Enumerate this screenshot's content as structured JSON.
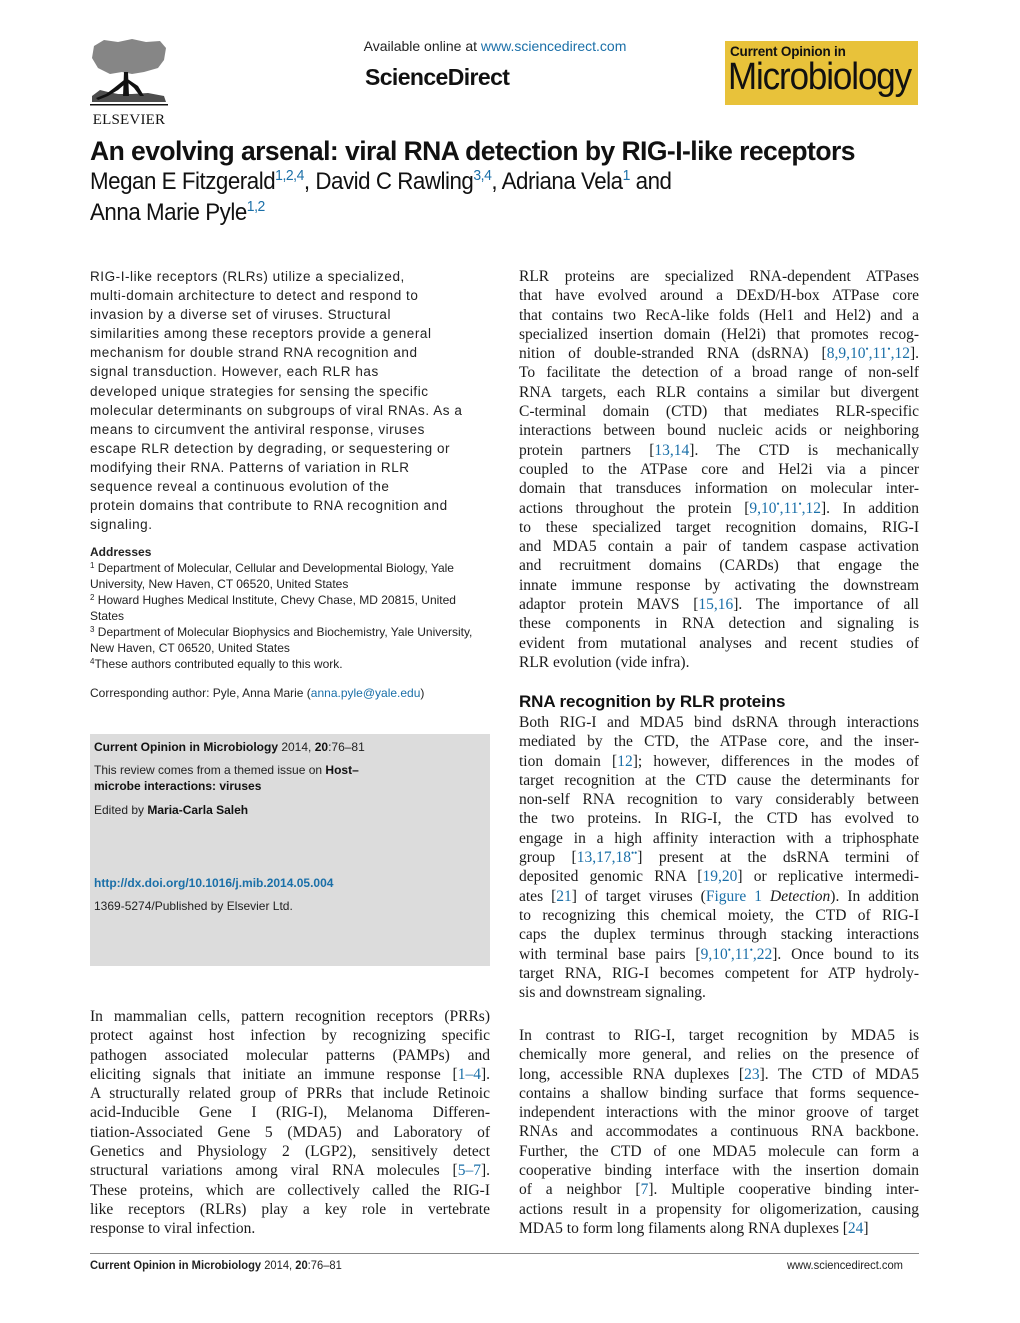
{
  "header": {
    "publisher_logo_text": "ELSEVIER",
    "available_prefix": "Available online at ",
    "available_link": "www.sciencedirect.com",
    "platform_name": "ScienceDirect",
    "journal_badge_small": "Current Opinion in",
    "journal_badge_large": "Microbiology",
    "journal_badge_color": "#e8c23a"
  },
  "article": {
    "title": "An evolving arsenal: viral RNA detection by RIG-I-like receptors",
    "authors": [
      {
        "name": "Megan E Fitzgerald",
        "affil": "1,2,4",
        "sep": ", "
      },
      {
        "name": "David C Rawling",
        "affil": "3,4",
        "sep": ", "
      },
      {
        "name": "Adriana Vela",
        "affil": "1",
        "sep": " and"
      },
      {
        "name": "Anna Marie Pyle",
        "affil": "1,2",
        "sep": ""
      }
    ]
  },
  "abstract_lines": [
    "RIG-I-like receptors (RLRs) utilize a specialized,",
    "multi-domain architecture to detect and respond to",
    "invasion by a diverse set of viruses. Structural",
    "similarities among these receptors provide a general",
    "mechanism for double strand RNA recognition and",
    "signal transduction. However, each RLR has",
    "developed unique strategies for sensing the specific",
    "molecular determinants on subgroups of viral RNAs. As a",
    "means to circumvent the antiviral response, viruses",
    "escape RLR detection by degrading, or sequestering or",
    "modifying their RNA. Patterns of variation in RLR",
    "sequence reveal a continuous evolution of the",
    "protein domains that contribute to RNA recognition and",
    "signaling."
  ],
  "addresses": {
    "heading": "Addresses",
    "lines": [
      {
        "sup": "1",
        "text": " Department of Molecular, Cellular and Developmental Biology, Yale"
      },
      {
        "sup": "",
        "text": "University, New Haven, CT 06520, United States"
      },
      {
        "sup": "2",
        "text": " Howard Hughes Medical Institute, Chevy Chase, MD 20815, United"
      },
      {
        "sup": "",
        "text": "States"
      },
      {
        "sup": "3",
        "text": " Department of Molecular Biophysics and Biochemistry, Yale University,"
      },
      {
        "sup": "",
        "text": "New Haven, CT 06520, United States"
      },
      {
        "sup": "4",
        "text": "These authors contributed equally to this work."
      }
    ],
    "corresponding_prefix": "Corresponding author: Pyle, Anna Marie (",
    "corresponding_email": "anna.pyle@yale.edu",
    "corresponding_suffix": ")"
  },
  "infobox": {
    "journal": "Current Opinion in Microbiology",
    "year": " 2014, ",
    "volume": "20",
    "pages": ":76–81",
    "themed_prefix": "This review comes from a themed issue on ",
    "themed_issue_1": "Host–",
    "themed_issue_2": "microbe interactions: viruses",
    "edited_prefix": "Edited by ",
    "editor": "Maria-Carla Saleh",
    "doi": "http://dx.doi.org/10.1016/j.mib.2014.05.004",
    "issn": "1369-5274/Published by Elsevier Ltd."
  },
  "body": {
    "intro": [
      [
        {
          "t": "In mammalian cells, pattern recognition receptors (PRRs)"
        }
      ],
      [
        {
          "t": "protect against host infection by recognizing specific"
        }
      ],
      [
        {
          "t": "pathogen associated molecular patterns (PAMPs) and"
        }
      ],
      [
        {
          "t": "eliciting signals that initiate an immune response ["
        },
        {
          "t": "1–4",
          "k": "link"
        },
        {
          "t": "]."
        }
      ],
      [
        {
          "t": "A structurally related group of PRRs that include Retinoic"
        }
      ],
      [
        {
          "t": "acid-Inducible Gene I (RIG-I), Melanoma Differen-"
        }
      ],
      [
        {
          "t": "tiation-Associated Gene 5 (MDA5) and Laboratory of"
        }
      ],
      [
        {
          "t": "Genetics and Physiology 2 (LGP2), sensitively detect"
        }
      ],
      [
        {
          "t": "structural variations among viral RNA molecules ["
        },
        {
          "t": "5–7",
          "k": "link"
        },
        {
          "t": "]."
        }
      ],
      [
        {
          "t": "These proteins, which are collectively called the RIG-I"
        }
      ],
      [
        {
          "t": "like receptors (RLRs) play a key role in vertebrate"
        }
      ],
      [
        {
          "t": "response to viral infection."
        }
      ]
    ],
    "right1": [
      [
        {
          "t": "RLR proteins are specialized RNA-dependent ATPases"
        }
      ],
      [
        {
          "t": "that have evolved around a DExD/H-box ATPase core"
        }
      ],
      [
        {
          "t": "that contains two RecA-like folds (Hel1 and Hel2) and a"
        }
      ],
      [
        {
          "t": "specialized insertion domain (Hel2i) that promotes recog-"
        }
      ],
      [
        {
          "t": "nition of double-stranded RNA (dsRNA) ["
        },
        {
          "t": "8,9,10",
          "k": "link"
        },
        {
          "t": "•",
          "k": "sup"
        },
        {
          "t": ",11",
          "k": "link"
        },
        {
          "t": "•",
          "k": "sup"
        },
        {
          "t": ",12",
          "k": "link"
        },
        {
          "t": "]."
        }
      ],
      [
        {
          "t": "To facilitate the detection of a broad range of non-self"
        }
      ],
      [
        {
          "t": "RNA targets, each RLR contains a similar but divergent"
        }
      ],
      [
        {
          "t": "C-terminal domain (CTD) that mediates RLR-specific"
        }
      ],
      [
        {
          "t": "interactions between bound nucleic acids or neighboring"
        }
      ],
      [
        {
          "t": "protein partners ["
        },
        {
          "t": "13,14",
          "k": "link"
        },
        {
          "t": "]. The CTD is mechanically"
        }
      ],
      [
        {
          "t": "coupled to the ATPase core and Hel2i via a pincer"
        }
      ],
      [
        {
          "t": "domain that transduces information on molecular inter-"
        }
      ],
      [
        {
          "t": "actions throughout the protein ["
        },
        {
          "t": "9,10",
          "k": "link"
        },
        {
          "t": "•",
          "k": "sup"
        },
        {
          "t": ",11",
          "k": "link"
        },
        {
          "t": "•",
          "k": "sup"
        },
        {
          "t": ",12",
          "k": "link"
        },
        {
          "t": "]. In addition"
        }
      ],
      [
        {
          "t": "to these specialized target recognition domains, RIG-I"
        }
      ],
      [
        {
          "t": "and MDA5 contain a pair of tandem caspase activation"
        }
      ],
      [
        {
          "t": "and recruitment domains (CARDs) that engage the"
        }
      ],
      [
        {
          "t": "innate immune response by activating the downstream"
        }
      ],
      [
        {
          "t": "adaptor protein MAVS ["
        },
        {
          "t": "15,16",
          "k": "link"
        },
        {
          "t": "]. The importance of all"
        }
      ],
      [
        {
          "t": "these components in RNA detection and signaling is"
        }
      ],
      [
        {
          "t": "evident from mutational analyses and recent studies of"
        }
      ],
      [
        {
          "t": "RLR evolution (vide infra)."
        }
      ]
    ],
    "section_heading": "RNA recognition by RLR proteins",
    "right2": [
      [
        {
          "t": "Both RIG-I and MDA5 bind dsRNA through interactions"
        }
      ],
      [
        {
          "t": "mediated by the CTD, the ATPase core, and the inser-"
        }
      ],
      [
        {
          "t": "tion domain ["
        },
        {
          "t": "12",
          "k": "link"
        },
        {
          "t": "]; however, differences in the modes of"
        }
      ],
      [
        {
          "t": "target recognition at the CTD cause the determinants for"
        }
      ],
      [
        {
          "t": "non-self RNA recognition to vary considerably between"
        }
      ],
      [
        {
          "t": "the two proteins. In RIG-I, the CTD has evolved to"
        }
      ],
      [
        {
          "t": "engage in a high affinity interaction with a triphosphate"
        }
      ],
      [
        {
          "t": "group ["
        },
        {
          "t": "13,17,18",
          "k": "link"
        },
        {
          "t": "••",
          "k": "sup"
        },
        {
          "t": "] present at the dsRNA termini of"
        }
      ],
      [
        {
          "t": "deposited genomic RNA ["
        },
        {
          "t": "19,20",
          "k": "link"
        },
        {
          "t": "] or replicative intermedi-"
        }
      ],
      [
        {
          "t": "ates ["
        },
        {
          "t": "21",
          "k": "link"
        },
        {
          "t": "] of target viruses ("
        },
        {
          "t": "Figure 1",
          "k": "link"
        },
        {
          "t": " "
        },
        {
          "t": "Detection",
          "k": "italic"
        },
        {
          "t": "). In addition"
        }
      ],
      [
        {
          "t": "to recognizing this chemical moiety, the CTD of RIG-I"
        }
      ],
      [
        {
          "t": "caps the duplex terminus through stacking interactions"
        }
      ],
      [
        {
          "t": "with terminal base pairs ["
        },
        {
          "t": "9,10",
          "k": "link"
        },
        {
          "t": "•",
          "k": "sup"
        },
        {
          "t": ",11",
          "k": "link"
        },
        {
          "t": "•",
          "k": "sup"
        },
        {
          "t": ",22",
          "k": "link"
        },
        {
          "t": "]. Once bound to its"
        }
      ],
      [
        {
          "t": "target RNA, RIG-I becomes competent for ATP hydroly-"
        }
      ],
      [
        {
          "t": "sis and downstream signaling."
        }
      ]
    ],
    "right3": [
      [
        {
          "t": "In contrast to RIG-I, target recognition by MDA5 is"
        }
      ],
      [
        {
          "t": "chemically more general, and relies on the presence of"
        }
      ],
      [
        {
          "t": "long, accessible RNA duplexes ["
        },
        {
          "t": "23",
          "k": "link"
        },
        {
          "t": "]. The CTD of MDA5"
        }
      ],
      [
        {
          "t": "contains a shallow binding surface that forms sequence-"
        }
      ],
      [
        {
          "t": "independent interactions with the minor groove of target"
        }
      ],
      [
        {
          "t": "RNAs and accommodates a continuous RNA backbone."
        }
      ],
      [
        {
          "t": "Further, the CTD of one MDA5 molecule can form a"
        }
      ],
      [
        {
          "t": "cooperative binding interface with the insertion domain"
        }
      ],
      [
        {
          "t": "of a neighbor ["
        },
        {
          "t": "7",
          "k": "link"
        },
        {
          "t": "]. Multiple cooperative binding inter-"
        }
      ],
      [
        {
          "t": "actions result in a propensity for oligomerization, causing"
        }
      ],
      [
        {
          "t": "MDA5 to form long filaments along RNA duplexes ["
        },
        {
          "t": "24",
          "k": "link"
        },
        {
          "t": "]"
        }
      ]
    ]
  },
  "footer": {
    "journal": "Current Opinion in Microbiology",
    "year": " 2014, ",
    "volume": "20",
    "pages": ":76–81",
    "site": "www.sciencedirect.com"
  },
  "colors": {
    "link": "#1a6fa8",
    "infobox_bg": "#dcdcdc"
  }
}
